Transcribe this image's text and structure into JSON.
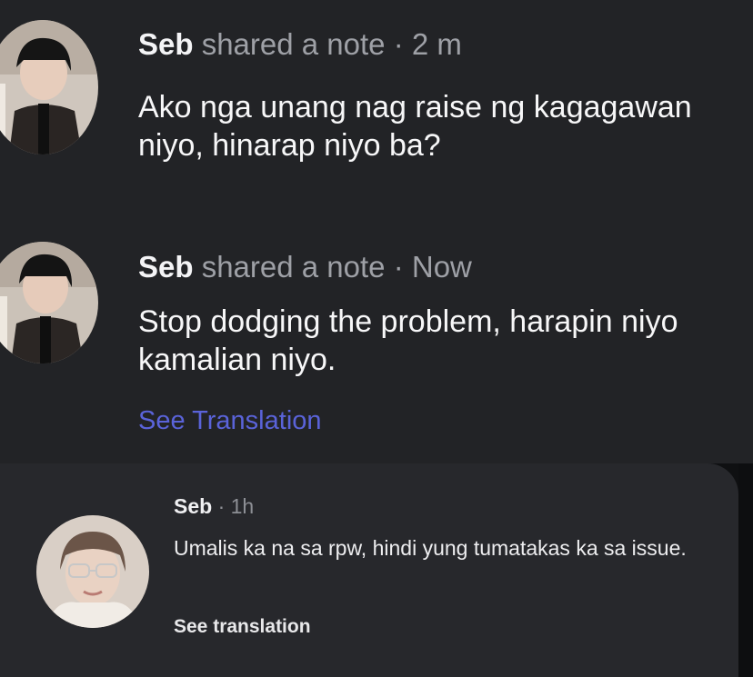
{
  "notes": [
    {
      "author": "Seb",
      "action": " shared a note",
      "separator": " · ",
      "time": "2 m",
      "body": "Ako nga unang nag raise ng kagagawan niyo, hinarap niyo ba?"
    },
    {
      "author": "Seb",
      "action": " shared a note",
      "separator": " · ",
      "time": "Now",
      "body": "Stop dodging the problem, harapin niyo kamalian niyo.",
      "see_translation": "See Translation"
    }
  ],
  "comment": {
    "author": "Seb",
    "separator": " · ",
    "time": "1h",
    "body": "Umalis ka na sa rpw, hindi yung tumatakas ka sa issue.",
    "see_translation": "See translation"
  },
  "colors": {
    "background": "#222326",
    "link": "#5a63d9",
    "card": "#27282c"
  }
}
